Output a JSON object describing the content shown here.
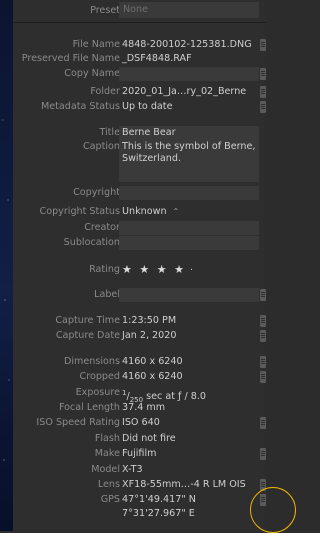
{
  "preset": {
    "label": "Preset",
    "value": "None"
  },
  "file_info": [
    {
      "label": "File Name",
      "value": "4848-200102-125381.DNG",
      "button": true
    },
    {
      "label": "Preserved File Name",
      "value": "_DSF4848.RAF",
      "button": false
    },
    {
      "label": "Copy Name",
      "value": "",
      "button": true
    },
    {
      "label": "Folder",
      "value": "2020_01_Ja…ry_02_Berne",
      "button": true
    },
    {
      "label": "Metadata Status",
      "value": "Up to date",
      "button": true
    }
  ],
  "ip": {
    "title_label": "Title",
    "title_value": "Berne Bear",
    "caption_label": "Caption",
    "caption_value": "This is the symbol of Berne, Switzerland.",
    "copyright_label": "Copyright",
    "copyright_value": "",
    "copyright_status_label": "Copyright Status",
    "copyright_status_value": "Unknown",
    "creator_label": "Creator",
    "creator_value": "",
    "sublocation_label": "Sublocation",
    "sublocation_value": ""
  },
  "rating": {
    "label": "Rating",
    "stars": "★ ★ ★ ★",
    "dot": "·"
  },
  "label_field": {
    "label": "Label",
    "value": ""
  },
  "capture": [
    {
      "label": "Capture Time",
      "value": "1:23:50 PM",
      "button": true
    },
    {
      "label": "Capture Date",
      "value": "Jan 2, 2020",
      "button": true
    }
  ],
  "exif": {
    "dimensions_label": "Dimensions",
    "dimensions_value": "4160 x 6240",
    "cropped_label": "Cropped",
    "cropped_value": "4160 x 6240",
    "exposure_label": "Exposure",
    "exposure_num": "1",
    "exposure_den": "250",
    "exposure_rest": "sec at ƒ / 8.0",
    "focal_label": "Focal Length",
    "focal_value": "37.4 mm",
    "iso_label": "ISO Speed Rating",
    "iso_value": "ISO 640",
    "flash_label": "Flash",
    "flash_value": "Did not fire",
    "make_label": "Make",
    "make_value": "Fujifilm",
    "model_label": "Model",
    "model_value": "X-T3",
    "lens_label": "Lens",
    "lens_value": "XF18-55mm…-4 R LM OIS",
    "gps_label": "GPS",
    "gps_line1": "47°1'49.417\" N",
    "gps_line2": "7°31'27.967\" E"
  },
  "colors": {
    "panel": "#2e2e2e",
    "field": "#3a3a3a",
    "highlight": "#f0b400"
  }
}
